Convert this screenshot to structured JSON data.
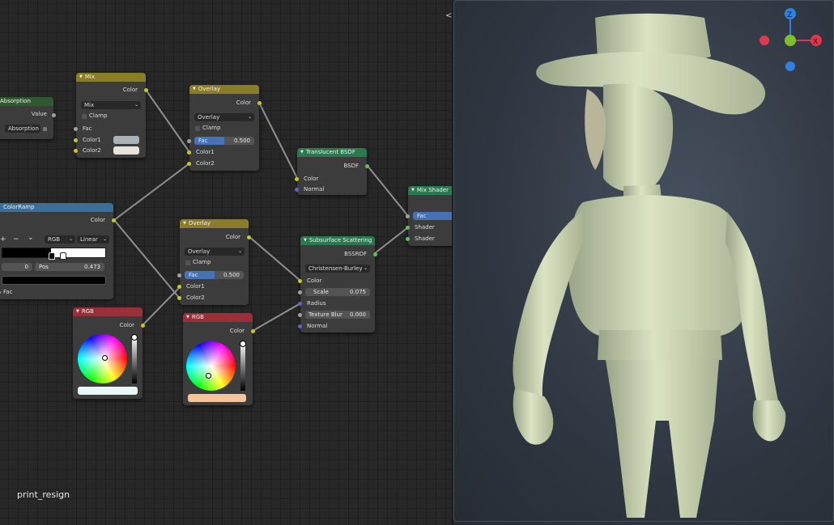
{
  "editor": {
    "label": "print_resign",
    "split_arrows": "<>"
  },
  "nodes": {
    "absorption": {
      "title": "Absorption",
      "out_value": "Value",
      "dropdown": "Absorption"
    },
    "mix": {
      "title": "Mix",
      "out_color": "Color",
      "mode": "Mix",
      "clamp": "Clamp",
      "fac": "Fac",
      "color1": "Color1",
      "color2": "Color2",
      "color1_hex": "#aab4b8",
      "color2_hex": "#e6e4dc"
    },
    "overlay1": {
      "title": "Overlay",
      "out_color": "Color",
      "mode": "Overlay",
      "clamp": "Clamp",
      "fac_label": "Fac",
      "fac_value": "0.500",
      "fac_fraction": 0.5,
      "color1": "Color1",
      "color2": "Color2"
    },
    "colorramp": {
      "title": "ColorRamp",
      "out_color": "Color",
      "plus": "+",
      "minus": "−",
      "chev": "⌄",
      "color_mode": "RGB",
      "interp": "Linear",
      "index": "0",
      "pos_label": "Pos",
      "pos_value": "0.473",
      "pos_fraction": 0.473,
      "fac": "Fac"
    },
    "translucent": {
      "title": "Translucent BSDF",
      "out": "BSDF",
      "in_color": "Color",
      "in_normal": "Normal"
    },
    "mixshader": {
      "title": "Mix Shader",
      "fac": "Fac",
      "shader1": "Shader",
      "shader2": "Shader"
    },
    "overlay2": {
      "title": "Overlay",
      "out_color": "Color",
      "mode": "Overlay",
      "clamp": "Clamp",
      "fac_label": "Fac",
      "fac_value": "0.500",
      "fac_fraction": 0.5,
      "color1": "Color1",
      "color2": "Color2"
    },
    "sss": {
      "title": "Subsurface Scattering",
      "out": "BSSRDF",
      "method": "Christensen-Burley",
      "in_color": "Color",
      "scale_label": "Scale",
      "scale_value": "0.075",
      "radius": "Radius",
      "blur_label": "Texture Blur",
      "blur_value": "0.000",
      "in_normal": "Normal"
    },
    "rgb1": {
      "title": "RGB",
      "out_color": "Color",
      "swatch_hex": "#eaf7f8"
    },
    "rgb2": {
      "title": "RGB",
      "out_color": "Color",
      "swatch_hex": "#f5c498"
    }
  },
  "viewport": {
    "gizmo": {
      "z": "Z",
      "x": "X",
      "x_color": "#e0384c",
      "y_color": "#7fbf2a",
      "z_color": "#2f80e0"
    },
    "model_color": "#d2dcb8"
  }
}
